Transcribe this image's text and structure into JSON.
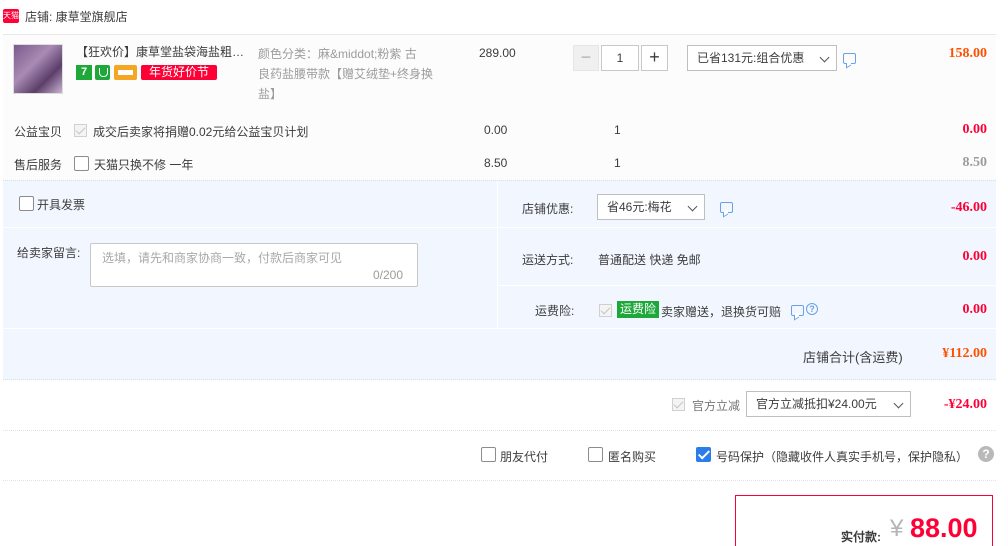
{
  "shop": {
    "badge": "天猫",
    "name": "店铺: 康草堂旗舰店"
  },
  "item": {
    "title": "【狂欢价】康草堂盐袋海盐粗盐热敷包",
    "badge_seven": "7",
    "promo_badge": "年货好价节",
    "sku_line1": "颜色分类：麻&middot;粉紫 古",
    "sku_line2": "良药盐腰带款【赠艾绒垫+终身换",
    "sku_line3": "盐】",
    "price": "289.00",
    "qty_minus": "−",
    "qty_value": "1",
    "qty_plus": "+",
    "discount_select": "已省131元:组合优惠",
    "total": "158.00"
  },
  "charity": {
    "label": "公益宝贝",
    "text": "成交后卖家将捐赠0.02元给公益宝贝计划",
    "price": "0.00",
    "qty": "1",
    "total": "0.00"
  },
  "aftersale": {
    "label": "售后服务",
    "text": "天猫只换不修 一年",
    "price": "8.50",
    "qty": "1",
    "total": "8.50"
  },
  "invoice": {
    "label": "开具发票"
  },
  "message": {
    "label": "给卖家留言:",
    "placeholder": "选填，请先和商家协商一致，付款后商家可见",
    "counter": "0/200"
  },
  "shop_discount": {
    "label": "店铺优惠:",
    "select": "省46元:梅花",
    "value": "-46.00"
  },
  "shipping": {
    "label": "运送方式:",
    "text": "普通配送 快递 免邮",
    "value": "0.00"
  },
  "freight_insurance": {
    "label": "运费险:",
    "tag": "运费险",
    "text": "卖家赠送，退换货可赔",
    "value": "0.00"
  },
  "shop_total": {
    "label": "店铺合计(含运费)",
    "value": "¥112.00"
  },
  "official_discount": {
    "label": "官方立减",
    "select": "官方立减抵扣¥24.00元",
    "value": "-¥24.00"
  },
  "options": {
    "friend_pay": "朋友代付",
    "anonymous": "匿名购买",
    "number_protect": "号码保护（隐藏收件人真实手机号，保护隐私）",
    "help": "?"
  },
  "payment": {
    "label": "实付款:",
    "currency": "¥",
    "amount": "88.00"
  },
  "colors": {
    "orange": "#ff5000",
    "red": "#ff0036",
    "panel_blue": "#f2f7ff",
    "green_tag": "#1ea83a",
    "check_blue": "#2b7de9"
  }
}
